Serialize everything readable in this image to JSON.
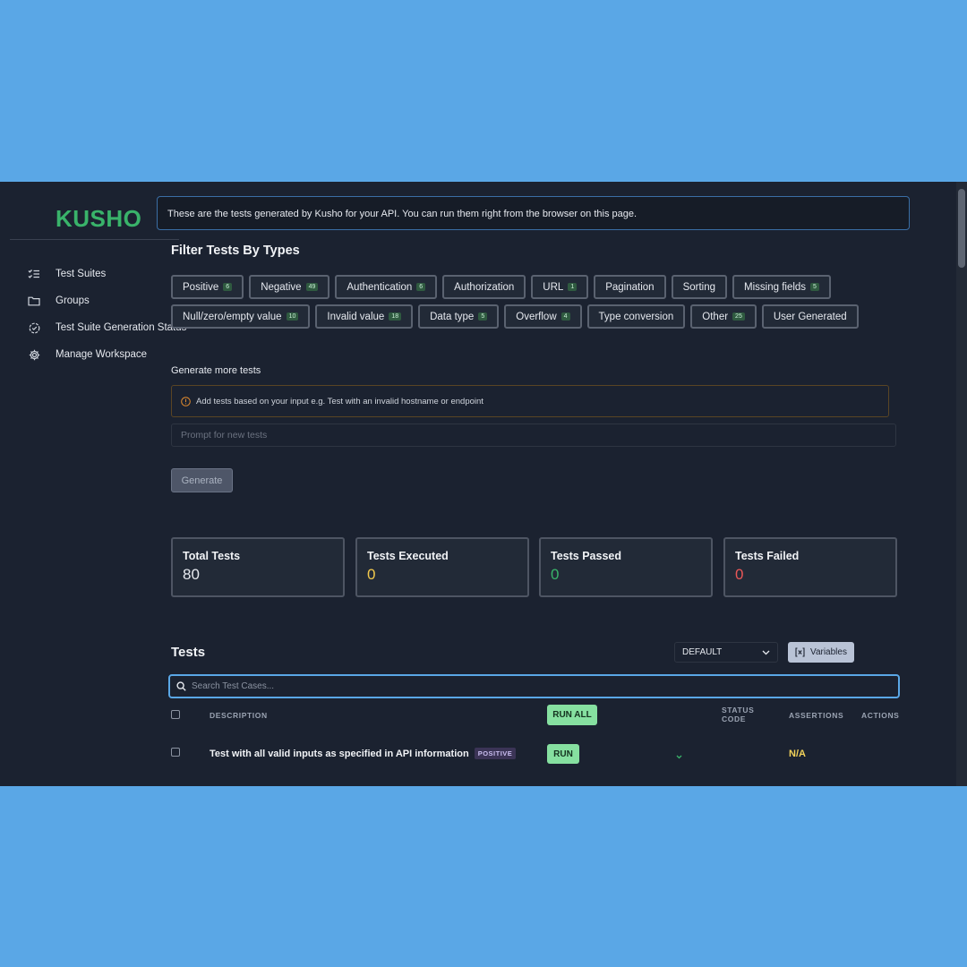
{
  "app": {
    "logo": "KUSHO"
  },
  "sidebar": {
    "items": [
      {
        "label": "Test Suites",
        "icon": "list-check-icon"
      },
      {
        "label": "Groups",
        "icon": "folder-icon"
      },
      {
        "label": "Test Suite Generation Status",
        "icon": "status-check-icon"
      },
      {
        "label": "Manage Workspace",
        "icon": "gear-icon"
      }
    ]
  },
  "banner": {
    "text": "These are the tests generated by Kusho for your API. You can run them right from the browser on this page."
  },
  "filters": {
    "title": "Filter Tests By Types",
    "chips": [
      {
        "label": "Positive",
        "count": "6"
      },
      {
        "label": "Negative",
        "count": "49"
      },
      {
        "label": "Authentication",
        "count": "6"
      },
      {
        "label": "Authorization",
        "count": ""
      },
      {
        "label": "URL",
        "count": "1"
      },
      {
        "label": "Pagination",
        "count": ""
      },
      {
        "label": "Sorting",
        "count": ""
      },
      {
        "label": "Missing fields",
        "count": "5"
      },
      {
        "label": "Null/zero/empty value",
        "count": "10"
      },
      {
        "label": "Invalid value",
        "count": "18"
      },
      {
        "label": "Data type",
        "count": "5"
      },
      {
        "label": "Overflow",
        "count": "4"
      },
      {
        "label": "Type conversion",
        "count": ""
      },
      {
        "label": "Other",
        "count": "25"
      },
      {
        "label": "User Generated",
        "count": ""
      }
    ]
  },
  "generate": {
    "title": "Generate more tests",
    "info": "Add tests based on your input e.g. Test with an invalid hostname or endpoint",
    "placeholder": "Prompt for new tests",
    "button": "Generate"
  },
  "stats": [
    {
      "label": "Total Tests",
      "value": "80",
      "color": "#e6e9ef"
    },
    {
      "label": "Tests Executed",
      "value": "0",
      "color": "#f2c94c"
    },
    {
      "label": "Tests Passed",
      "value": "0",
      "color": "#39b36a"
    },
    {
      "label": "Tests Failed",
      "value": "0",
      "color": "#eb5757"
    }
  ],
  "tests": {
    "title": "Tests",
    "select_value": "DEFAULT",
    "variables_label": "Variables",
    "search_placeholder": "Search Test Cases...",
    "columns": {
      "description": "DESCRIPTION",
      "run_all": "RUN ALL",
      "status_line1": "STATUS",
      "status_line2": "CODE",
      "assertions": "ASSERTIONS",
      "actions": "ACTIONS"
    },
    "rows": [
      {
        "description": "Test with all valid inputs as specified in API information",
        "tag": "POSITIVE",
        "run_label": "RUN",
        "assertions": "N/A"
      }
    ]
  },
  "colors": {
    "accent": "#5aa7e6",
    "brand": "#39b36a",
    "background": "#1b2230"
  }
}
